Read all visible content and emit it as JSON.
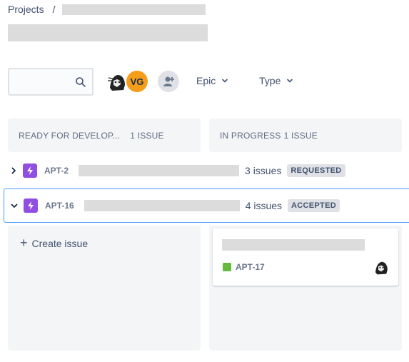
{
  "breadcrumb": {
    "root": "Projects",
    "separator": "/"
  },
  "toolbar": {
    "search_placeholder": "",
    "avatar_initials": "VG",
    "filters": [
      {
        "label": "Epic"
      },
      {
        "label": "Type"
      }
    ]
  },
  "columns": [
    {
      "name": "READY FOR DEVELOP...",
      "count": "1 ISSUE"
    },
    {
      "name": "IN PROGRESS",
      "count": "1 ISSUE"
    }
  ],
  "swimlanes": [
    {
      "key": "APT-2",
      "issues": "3 issues",
      "status": "REQUESTED",
      "expanded": false
    },
    {
      "key": "APT-16",
      "issues": "4 issues",
      "status": "ACCEPTED",
      "expanded": true
    }
  ],
  "board": {
    "create_issue": "Create issue",
    "card": {
      "key": "APT-17"
    }
  },
  "colors": {
    "epic": "#904ee2",
    "story": "#63ba3c",
    "avatar_vg": "#f49d1b",
    "selected_border": "#4c9aff"
  },
  "icons": [
    "search-icon",
    "chevron-down-icon",
    "chevron-right-icon",
    "add-people-icon",
    "lightning-icon",
    "bookmark-icon",
    "plus-icon"
  ]
}
